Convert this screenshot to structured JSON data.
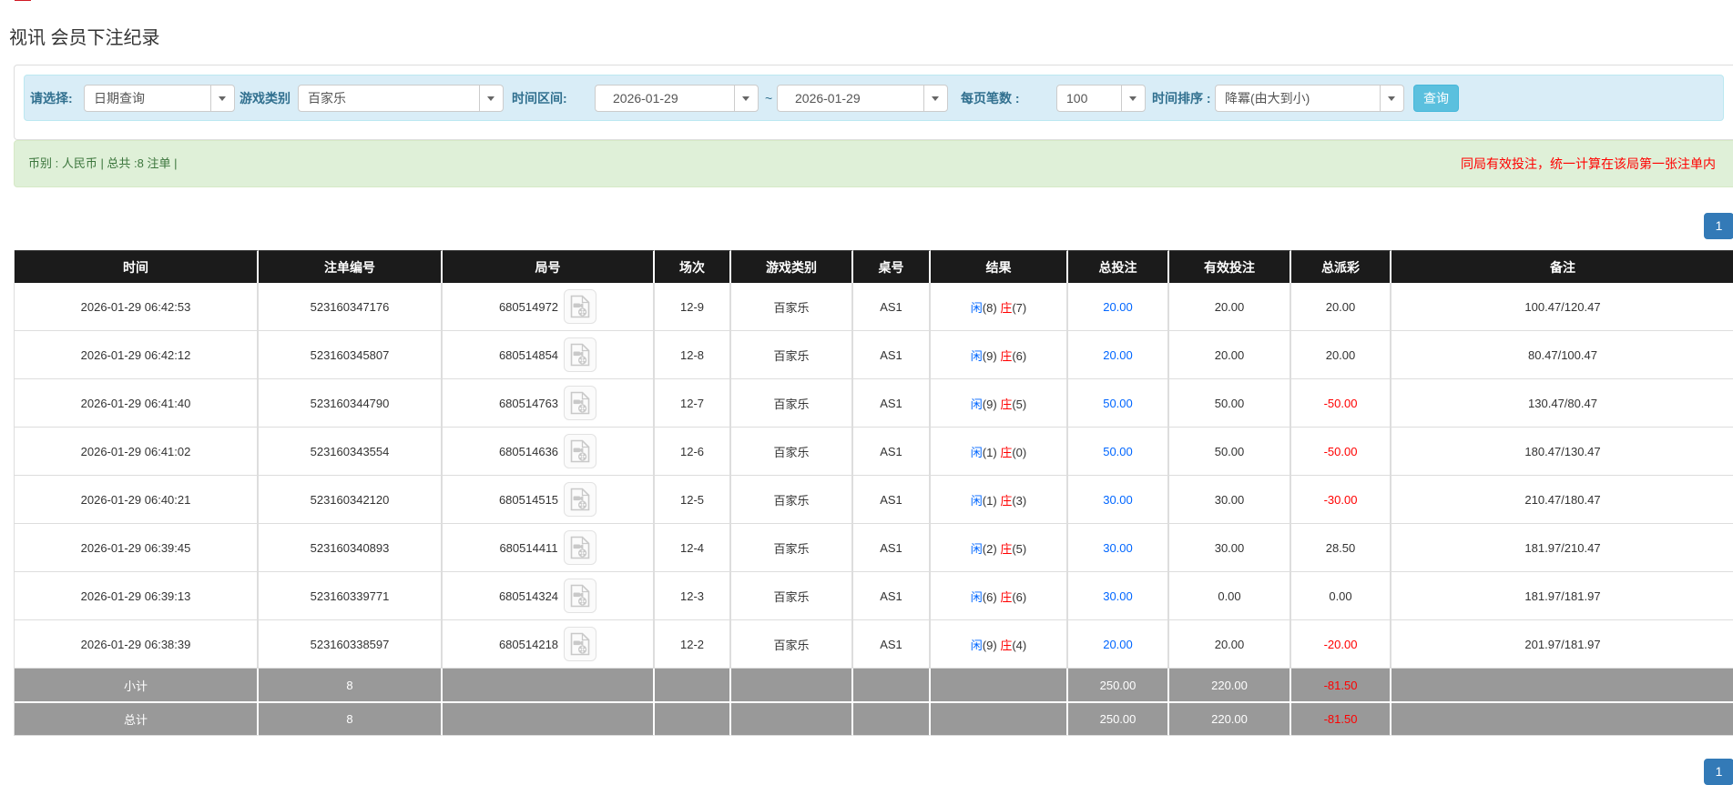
{
  "page_title": "视讯 会员下注纪录",
  "filter_bar": {
    "select_label": "请选择:",
    "query_type": "日期查询",
    "game_category_label": "游戏类别",
    "game_category": "百家乐",
    "time_range_label": "时间区间:",
    "date_from": "2026-01-29",
    "range_separator": "~",
    "date_to": "2026-01-29",
    "page_size_label": "每页笔数 :",
    "page_size": "100",
    "time_sort_label": "时间排序 :",
    "time_sort": "降冪(由大到小)",
    "search_button": "查询"
  },
  "summary_bar": {
    "left_text": "币别 : 人民币 | 总共 :8 注单 |",
    "right_note": "同局有效投注，统一计算在该局第一张注单内"
  },
  "pagination": {
    "current_page": "1"
  },
  "table": {
    "columns": [
      "时间",
      "注单编号",
      "局号",
      "场次",
      "游戏类别",
      "桌号",
      "结果",
      "总投注",
      "有效投注",
      "总派彩",
      "备注"
    ],
    "result_labels": {
      "player": "闲",
      "banker": "庄"
    },
    "rows": [
      {
        "time": "2026-01-29 06:42:53",
        "bet_id": "523160347176",
        "round_id": "680514972",
        "session": "12-9",
        "game": "百家乐",
        "table_no": "AS1",
        "player_score": "8",
        "banker_score": "7",
        "total_bet": "20.00",
        "valid_bet": "20.00",
        "payout": "20.00",
        "remark": "100.47/120.47"
      },
      {
        "time": "2026-01-29 06:42:12",
        "bet_id": "523160345807",
        "round_id": "680514854",
        "session": "12-8",
        "game": "百家乐",
        "table_no": "AS1",
        "player_score": "9",
        "banker_score": "6",
        "total_bet": "20.00",
        "valid_bet": "20.00",
        "payout": "20.00",
        "remark": "80.47/100.47"
      },
      {
        "time": "2026-01-29 06:41:40",
        "bet_id": "523160344790",
        "round_id": "680514763",
        "session": "12-7",
        "game": "百家乐",
        "table_no": "AS1",
        "player_score": "9",
        "banker_score": "5",
        "total_bet": "50.00",
        "valid_bet": "50.00",
        "payout": "-50.00",
        "remark": "130.47/80.47"
      },
      {
        "time": "2026-01-29 06:41:02",
        "bet_id": "523160343554",
        "round_id": "680514636",
        "session": "12-6",
        "game": "百家乐",
        "table_no": "AS1",
        "player_score": "1",
        "banker_score": "0",
        "total_bet": "50.00",
        "valid_bet": "50.00",
        "payout": "-50.00",
        "remark": "180.47/130.47"
      },
      {
        "time": "2026-01-29 06:40:21",
        "bet_id": "523160342120",
        "round_id": "680514515",
        "session": "12-5",
        "game": "百家乐",
        "table_no": "AS1",
        "player_score": "1",
        "banker_score": "3",
        "total_bet": "30.00",
        "valid_bet": "30.00",
        "payout": "-30.00",
        "remark": "210.47/180.47"
      },
      {
        "time": "2026-01-29 06:39:45",
        "bet_id": "523160340893",
        "round_id": "680514411",
        "session": "12-4",
        "game": "百家乐",
        "table_no": "AS1",
        "player_score": "2",
        "banker_score": "5",
        "total_bet": "30.00",
        "valid_bet": "30.00",
        "payout": "28.50",
        "remark": "181.97/210.47"
      },
      {
        "time": "2026-01-29 06:39:13",
        "bet_id": "523160339771",
        "round_id": "680514324",
        "session": "12-3",
        "game": "百家乐",
        "table_no": "AS1",
        "player_score": "6",
        "banker_score": "6",
        "total_bet": "30.00",
        "valid_bet": "0.00",
        "payout": "0.00",
        "remark": "181.97/181.97"
      },
      {
        "time": "2026-01-29 06:38:39",
        "bet_id": "523160338597",
        "round_id": "680514218",
        "session": "12-2",
        "game": "百家乐",
        "table_no": "AS1",
        "player_score": "9",
        "banker_score": "4",
        "total_bet": "20.00",
        "valid_bet": "20.00",
        "payout": "-20.00",
        "remark": "201.97/181.97"
      }
    ],
    "subtotal": {
      "label": "小计",
      "count": "8",
      "total_bet": "250.00",
      "valid_bet": "220.00",
      "payout": "-81.50"
    },
    "total": {
      "label": "总计",
      "count": "8",
      "total_bet": "250.00",
      "valid_bet": "220.00",
      "payout": "-81.50"
    }
  }
}
